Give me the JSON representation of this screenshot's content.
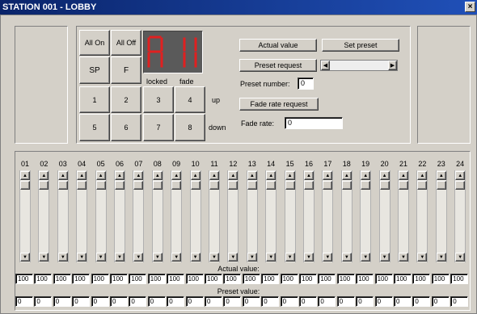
{
  "window": {
    "title": "STATION 001 - LOBBY",
    "close_glyph": "×"
  },
  "keypad": {
    "all_on": "All On",
    "all_off": "All Off",
    "sp": "SP",
    "f": "F",
    "numbers": [
      "1",
      "2",
      "3",
      "4",
      "5",
      "6",
      "7",
      "8"
    ]
  },
  "display": {
    "value": "A11",
    "locked_label": "locked",
    "fade_label": "fade",
    "color": "#e02020"
  },
  "direction": {
    "up": "up",
    "down": "down"
  },
  "controls": {
    "actual_value_btn": "Actual value",
    "set_preset_btn": "Set preset",
    "preset_request_btn": "Preset request",
    "preset_number_label": "Preset number:",
    "preset_number_value": "0",
    "fade_rate_request_btn": "Fade rate request",
    "fade_rate_label": "Fade rate:",
    "fade_rate_value": "0"
  },
  "channels": {
    "labels": [
      "01",
      "02",
      "03",
      "04",
      "05",
      "06",
      "07",
      "08",
      "09",
      "10",
      "11",
      "12",
      "13",
      "14",
      "15",
      "16",
      "17",
      "18",
      "19",
      "20",
      "21",
      "22",
      "23",
      "24"
    ],
    "actual_label": "Actual value:",
    "actual_values": [
      "100",
      "100",
      "100",
      "100",
      "100",
      "100",
      "100",
      "100",
      "100",
      "100",
      "100",
      "100",
      "100",
      "100",
      "100",
      "100",
      "100",
      "100",
      "100",
      "100",
      "100",
      "100",
      "100",
      "100"
    ],
    "preset_label": "Preset value:",
    "preset_values": [
      "0",
      "0",
      "0",
      "0",
      "0",
      "0",
      "0",
      "0",
      "0",
      "0",
      "0",
      "0",
      "0",
      "0",
      "0",
      "0",
      "0",
      "0",
      "0",
      "0",
      "0",
      "0",
      "0",
      "0"
    ]
  }
}
